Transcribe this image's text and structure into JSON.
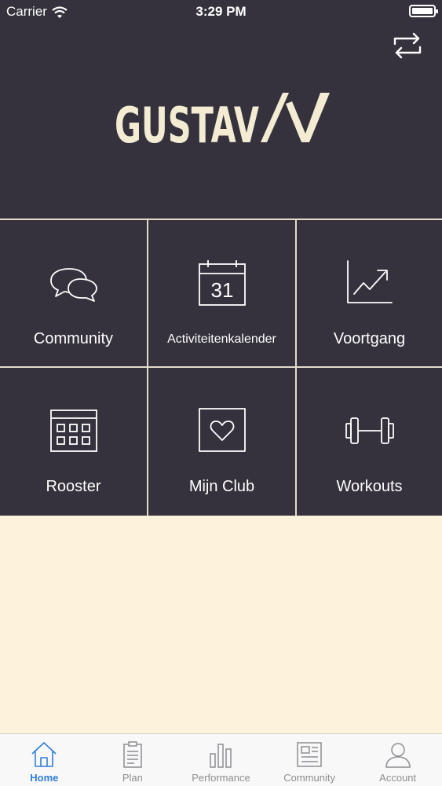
{
  "status_bar": {
    "carrier": "Carrier",
    "time": "3:29 PM"
  },
  "header": {
    "logo_text": "GUSTAV",
    "switch_icon": "swap-arrows-icon"
  },
  "tiles": [
    {
      "label": "Community",
      "icon": "chat-bubbles-icon"
    },
    {
      "label": "Activiteitenkalender",
      "icon": "calendar-icon",
      "calendar_day": "31"
    },
    {
      "label": "Voortgang",
      "icon": "progress-chart-icon"
    },
    {
      "label": "Rooster",
      "icon": "schedule-grid-icon"
    },
    {
      "label": "Mijn Club",
      "icon": "heart-icon"
    },
    {
      "label": "Workouts",
      "icon": "dumbbell-icon"
    }
  ],
  "tab_bar": {
    "items": [
      {
        "label": "Home",
        "icon": "home-icon",
        "active": true
      },
      {
        "label": "Plan",
        "icon": "clipboard-icon",
        "active": false
      },
      {
        "label": "Performance",
        "icon": "bar-chart-icon",
        "active": false
      },
      {
        "label": "Community",
        "icon": "newspaper-icon",
        "active": false
      },
      {
        "label": "Account",
        "icon": "person-icon",
        "active": false
      }
    ]
  },
  "colors": {
    "dark_background": "#35323d",
    "logo_cream": "#f3ecd2",
    "content_background": "#fdf2dc",
    "tab_active": "#2f7fd6",
    "tab_inactive": "#8e8e93"
  }
}
